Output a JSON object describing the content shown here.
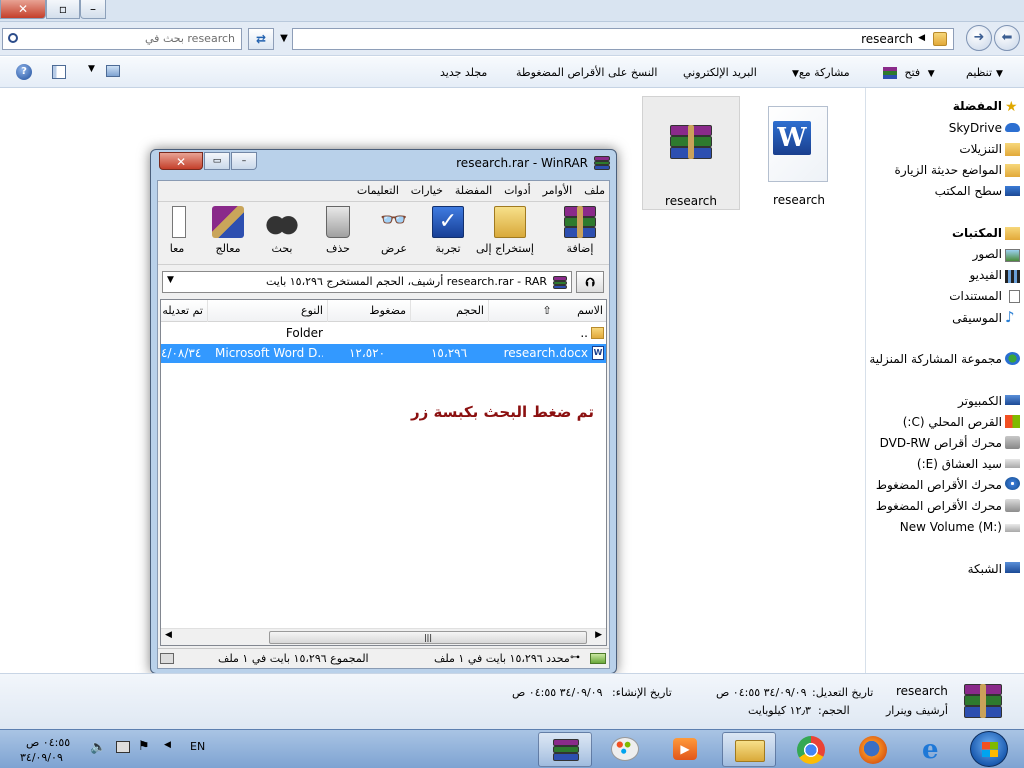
{
  "window": {
    "search_placeholder": "بحث في research",
    "address_path": "research"
  },
  "toolbar": {
    "organize": "تنظيم",
    "open": "فتح",
    "share": "مشاركة مع",
    "email": "البريد الإلكتروني",
    "burn": "النسخ على الأقراص المضغوطة",
    "new_folder": "مجلد جديد"
  },
  "files": [
    {
      "name": "research",
      "type": "winrar-archive",
      "selected": true
    },
    {
      "name": "research",
      "type": "word-document",
      "selected": false
    }
  ],
  "nav": {
    "favorites": "المفضلة",
    "skydrive": "SkyDrive",
    "downloads": "التنزيلات",
    "recent": "المواضع حديثة الزيارة",
    "desktop": "سطح المكتب",
    "libraries": "المكتبات",
    "pictures": "الصور",
    "videos": "الفيديو",
    "documents": "المستندات",
    "music": "الموسيقى",
    "homegroup": "مجموعة المشاركة المنزلية",
    "computer": "الكمبيوتر",
    "drive_c": "القرص المحلي (C:)",
    "drive_dvd": "محرك أقراص DVD-RW",
    "drive_e": "سيد العشاق (E:)",
    "drive_cd1": "محرك الأقراص المضغوط",
    "drive_cd2": "محرك الأقراص المضغوط",
    "drive_m": "New Volume (M:)",
    "network": "الشبكة"
  },
  "details": {
    "name": "research",
    "type": "أرشيف وينرار",
    "modified_label": "تاريخ التعديل:",
    "modified_value": "٣٤/٠٩/٠٩ ٠٤:٥٥ ص",
    "size_label": "الحجم:",
    "size_value": "١٢٫٣ كيلوبايت",
    "created_label": "تاريخ الإنشاء:",
    "created_value": "٣٤/٠٩/٠٩ ٠٤:٥٥ ص"
  },
  "winrar": {
    "title": "research.rar - WinRAR",
    "menu": [
      "ملف",
      "الأوامر",
      "أدوات",
      "المفضلة",
      "خيارات",
      "التعليمات"
    ],
    "tools": {
      "add": "إضافة",
      "extract": "إستخراج إلى",
      "test": "تجربة",
      "view": "عرض",
      "delete": "حذف",
      "find": "بحث",
      "wizard": "معالج",
      "info": "معا"
    },
    "path_text": "research.rar - RAR أرشيف، الحجم المستخرج ١٥،٢٩٦ بايت",
    "columns": {
      "name": "الاسم",
      "size": "الحجم",
      "packed": "مضغوط",
      "type": "النوع",
      "modified": "تم تعديله"
    },
    "rows": [
      {
        "name": "..",
        "size": "",
        "packed": "",
        "type": "Folder",
        "modified": ""
      },
      {
        "name": "research.docx",
        "size": "١٥،٢٩٦",
        "packed": "١٢،٥٢٠",
        "type": "Microsoft Word D...",
        "modified": "٤/٠٨/٣٤"
      }
    ],
    "annotation": "تم ضغط البحث بكبسة زر",
    "status_selected": "محدد ١٥،٢٩٦ بايت في ١ ملف",
    "status_total": "المجموع ١٥،٢٩٦ بايت في ١ ملف"
  },
  "taskbar": {
    "time": "٠٤:٥٥ ص",
    "date": "٣٤/٠٩/٠٩",
    "language": "EN"
  }
}
